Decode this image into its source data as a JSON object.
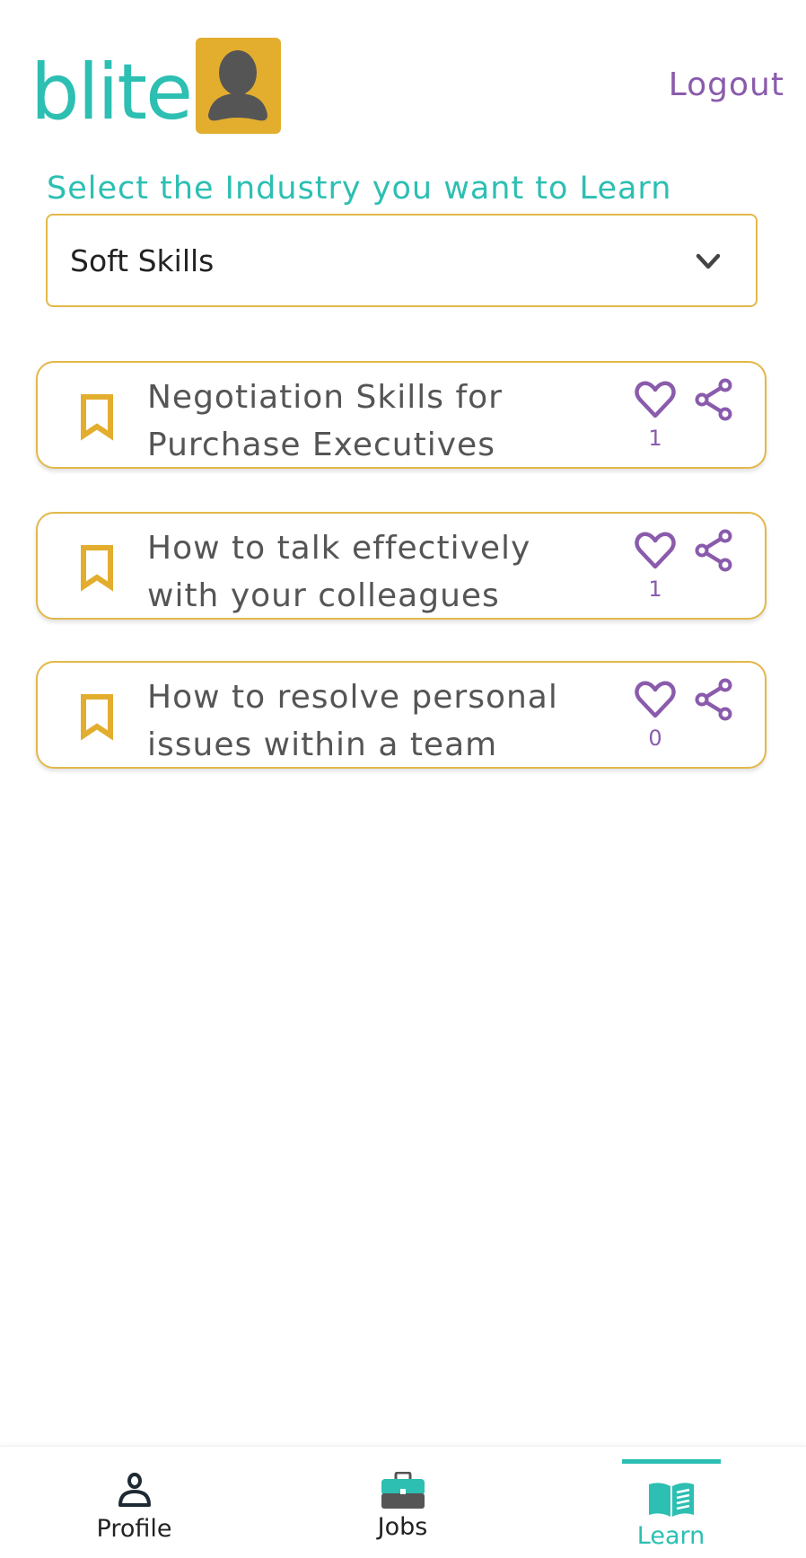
{
  "header": {
    "logo_text": "blite",
    "logout_label": "Logout"
  },
  "industry_select": {
    "label": "Select the Industry you want to Learn",
    "selected_value": "Soft Skills"
  },
  "courses": [
    {
      "title": "Negotiation Skills for Purchase Executives",
      "likes": "1"
    },
    {
      "title": "How to talk effectively with your colleagues",
      "likes": "1"
    },
    {
      "title": "How to resolve personal issues within a team",
      "likes": "0"
    }
  ],
  "bottom_nav": {
    "items": [
      {
        "label": "Profile",
        "icon": "person-icon",
        "active": false
      },
      {
        "label": "Jobs",
        "icon": "briefcase-icon",
        "active": false
      },
      {
        "label": "Learn",
        "icon": "book-icon",
        "active": true
      }
    ]
  },
  "colors": {
    "brand_teal": "#2cbfb2",
    "accent_gold": "#e3ae2e",
    "accent_purple": "#8a5bac",
    "text_dark": "#555555"
  }
}
